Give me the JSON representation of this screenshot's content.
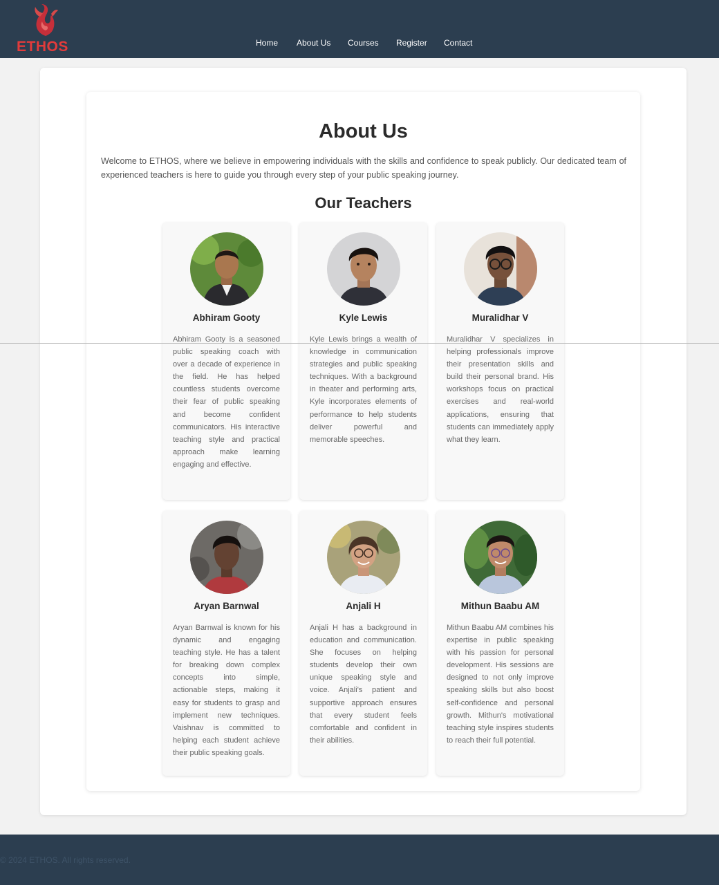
{
  "brand": {
    "logo_text": "ETHOS"
  },
  "nav": {
    "items": [
      {
        "label": "Home"
      },
      {
        "label": "About Us"
      },
      {
        "label": "Courses"
      },
      {
        "label": "Register"
      },
      {
        "label": "Contact"
      }
    ]
  },
  "main": {
    "title": "About Us",
    "intro": "Welcome to ETHOS, where we believe in empowering individuals with the skills and confidence to speak publicly. Our dedicated team of experienced teachers is here to guide you through every step of your public speaking journey.",
    "teachers_heading": "Our Teachers",
    "teachers": [
      {
        "name": "Abhiram Gooty",
        "bio": "Abhiram Gooty is a seasoned public speaking coach with over a decade of experience in the field. He has helped countless students overcome their fear of public speaking and become confident communicators. His interactive teaching style and practical approach make learning engaging and effective."
      },
      {
        "name": "Kyle Lewis",
        "bio": "Kyle Lewis brings a wealth of knowledge in communication strategies and public speaking techniques. With a background in theater and performing arts, Kyle incorporates elements of performance to help students deliver powerful and memorable speeches."
      },
      {
        "name": "Muralidhar V",
        "bio": "Muralidhar V specializes in helping professionals improve their presentation skills and build their personal brand. His workshops focus on practical exercises and real-world applications, ensuring that students can immediately apply what they learn."
      },
      {
        "name": "Aryan Barnwal",
        "bio": "Aryan Barnwal is known for his dynamic and engaging teaching style. He has a talent for breaking down complex concepts into simple, actionable steps, making it easy for students to grasp and implement new techniques. Vaishnav is committed to helping each student achieve their public speaking goals."
      },
      {
        "name": "Anjali H",
        "bio": "Anjali H has a background in education and communication. She focuses on helping students develop their own unique speaking style and voice. Anjali's patient and supportive approach ensures that every student feels comfortable and confident in their abilities."
      },
      {
        "name": "Mithun Baabu AM",
        "bio": "Mithun Baabu AM combines his expertise in public speaking with his passion for personal development. His sessions are designed to not only improve speaking skills but also boost self-confidence and personal growth. Mithun's motivational teaching style inspires students to reach their full potential."
      }
    ]
  },
  "footer": {
    "copyright": "© 2024 ETHOS. All rights reserved."
  },
  "colors": {
    "header_bg": "#2c3e50",
    "brand_red": "#e23b3b",
    "page_bg": "#f2f2f2",
    "card_bg": "#f8f8f8"
  }
}
